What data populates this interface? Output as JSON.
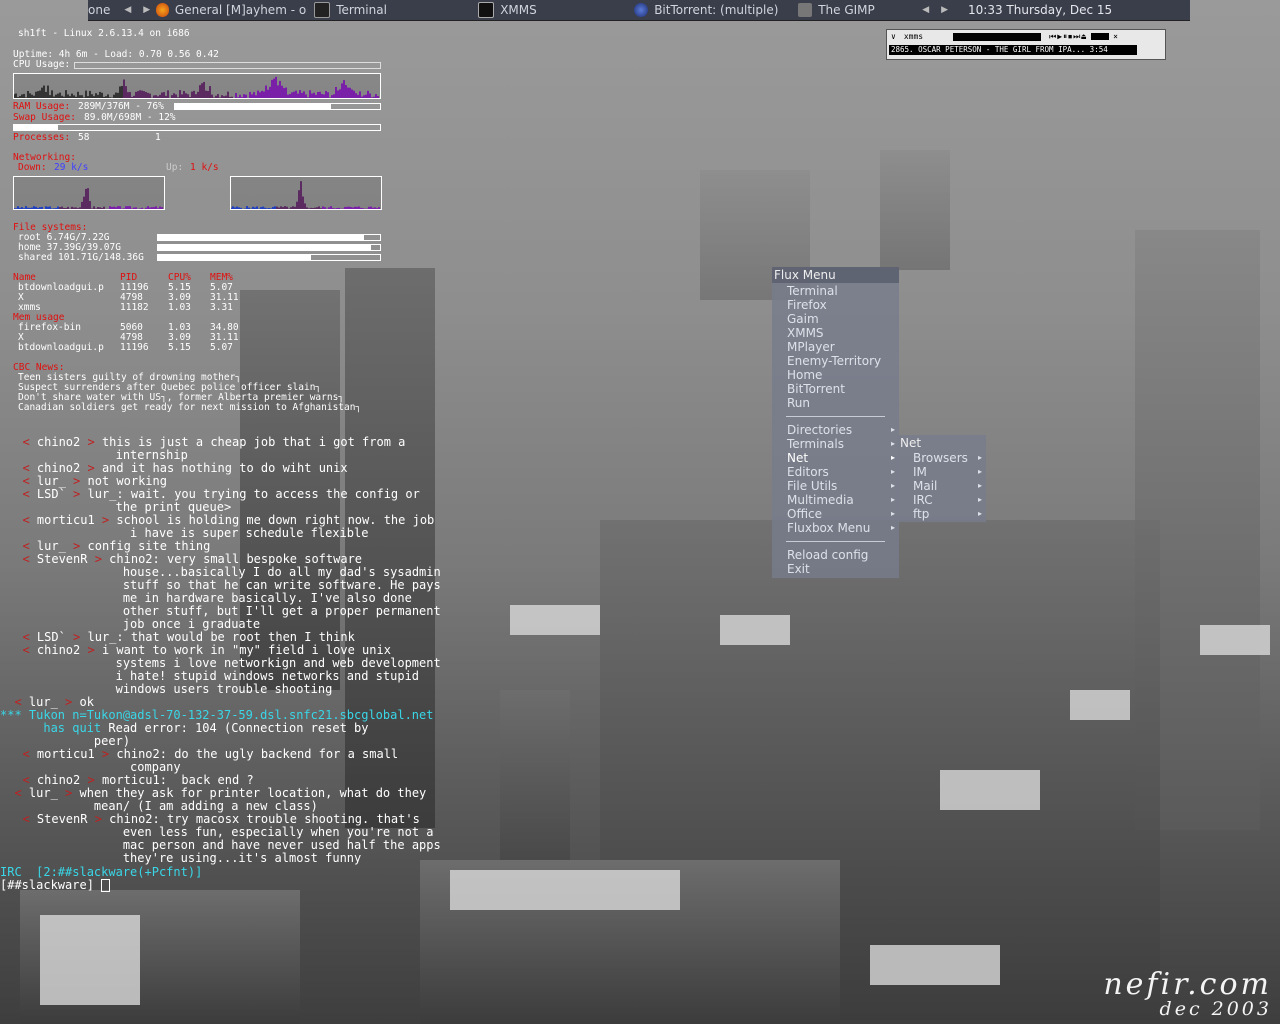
{
  "taskbar": {
    "items": [
      "one",
      "General [M]ayhem - o",
      "Terminal",
      "XMMS",
      "BitTorrent: (multiple)",
      "The GIMP"
    ],
    "clock": "10:33 Thursday, Dec 15"
  },
  "conky": {
    "header": "sh1ft - Linux 2.6.13.4 on i686",
    "uptime": "Uptime: 4h 6m - Load: 0.70 0.56 0.42",
    "cpu_label": "CPU Usage:",
    "ram_label": "RAM Usage:",
    "ram_value": "289M/376M - 76%",
    "ram_fraction": 0.76,
    "swap_label": "Swap Usage:",
    "swap_value": "89.0M/698M - 12%",
    "swap_fraction": 0.12,
    "processes_label": "Processes:",
    "processes_total": "58",
    "processes_running": "1",
    "network_label": "Networking:",
    "down_label": "Down:",
    "down_value": "29 k/s",
    "up_label": "Up:",
    "up_value": "1 k/s",
    "fs_label": "File systems:",
    "fs": [
      {
        "text": "root 6.74G/7.22G",
        "fraction": 0.93
      },
      {
        "text": "home 37.39G/39.07G",
        "fraction": 0.96
      },
      {
        "text": "shared 101.71G/148.36G",
        "fraction": 0.69
      }
    ],
    "top_headers": [
      "Name",
      "PID",
      "CPU%",
      "MEM%"
    ],
    "top_cpu": [
      [
        "btdownloadgui.p",
        "11196",
        "5.15",
        "5.07"
      ],
      [
        "X",
        "4798",
        "3.09",
        "31.11"
      ],
      [
        "xmms",
        "11182",
        "1.03",
        "3.31"
      ]
    ],
    "mem_label": "Mem usage",
    "top_mem": [
      [
        "firefox-bin",
        "5060",
        "1.03",
        "34.80"
      ],
      [
        "X",
        "4798",
        "3.09",
        "31.11"
      ],
      [
        "btdownloadgui.p",
        "11196",
        "5.15",
        "5.07"
      ]
    ],
    "cbc_label": "CBC News:",
    "news": [
      "Teen sisters guilty of drowning mother┐",
      "Suspect surrenders after Quebec police officer slain┐",
      "Don't share water with US┐, former Alberta premier warns┐",
      "Canadian soldiers get ready for next mission to Afghanistan┐"
    ]
  },
  "irc": {
    "lines": [
      {
        "nick": "chino2",
        "text": "this is just a cheap job that i got from a"
      },
      {
        "cont": "internship",
        "indent": "                "
      },
      {
        "nick": "chino2",
        "text": "and it has nothing to do wiht unix"
      },
      {
        "nick": "lur_",
        "text": "not working"
      },
      {
        "nick": "LSD`",
        "text": "lur_: wait. you trying to access the config or"
      },
      {
        "cont": "the print queue>",
        "indent": "                "
      },
      {
        "nick": "morticu1",
        "text": "school is holding me down right now. the job"
      },
      {
        "cont": "i have is super schedule flexible",
        "indent": "                  "
      },
      {
        "nick": "lur_",
        "text": "config site thing"
      },
      {
        "nick": "StevenR",
        "text": "chino2: very small bespoke software"
      },
      {
        "cont": "house...basically I do all my dad's sysadmin",
        "indent": "                 "
      },
      {
        "cont": "stuff so that he can write software. He pays",
        "indent": "                 "
      },
      {
        "cont": "me in hardware basically. I've also done",
        "indent": "                 "
      },
      {
        "cont": "other stuff, but I'll get a proper permanent",
        "indent": "                 "
      },
      {
        "cont": "job once i graduate",
        "indent": "                 "
      },
      {
        "nick": "LSD`",
        "text": "lur_: that would be root then I think"
      },
      {
        "nick": "chino2",
        "text": "i want to work in \"my\" field i love unix"
      },
      {
        "cont": "systems i love networkign and web development",
        "indent": "                "
      },
      {
        "cont": "i hate! stupid windows networks and stupid",
        "indent": "                "
      },
      {
        "cont": "windows users trouble shooting",
        "indent": "                "
      },
      {
        "nick": "lur_",
        "text": "ok",
        "self": true
      },
      {
        "quit": "*** Tukon n=Tukon@adsl-70-132-37-59.dsl.snfc21.sbcglobal.net"
      },
      {
        "quit2": "has quit",
        "reason": " Read error: 104 (Connection reset by"
      },
      {
        "cont": "peer)",
        "indent": "             "
      },
      {
        "nick": "morticu1",
        "text": "chino2: do the ugly backend for a small"
      },
      {
        "cont": "company",
        "indent": "                  "
      },
      {
        "nick": "chino2",
        "text": "morticu1:  back end ?"
      },
      {
        "nick": "lur_",
        "text": "when they ask for printer location, what do they",
        "self": true
      },
      {
        "cont": "mean/ (I am adding a new class)",
        "indent": "             "
      },
      {
        "nick": "StevenR",
        "text": "chino2: try macosx trouble shooting. that's"
      },
      {
        "cont": "even less fun, especially when you're not a",
        "indent": "                 "
      },
      {
        "cont": "mac person and have never used half the apps",
        "indent": "                 "
      },
      {
        "cont": "they're using...it's almost funny",
        "indent": "                 "
      }
    ],
    "status": "IRC  [2:##slackware(+Pcfnt)]",
    "prompt": "[##slackware] "
  },
  "xmms": {
    "title": "xmms",
    "song": "2865. OSCAR PETERSON - THE GIRL FROM IPA... 3:54"
  },
  "flux_menu": {
    "title": "Flux Menu",
    "apps": [
      "Terminal",
      "Firefox",
      "Gaim",
      "XMMS",
      "MPlayer",
      "Enemy-Territory",
      "Home",
      "BitTorrent",
      "Run"
    ],
    "submenus": [
      "Directories",
      "Terminals",
      "Net",
      "Editors",
      "File Utils",
      "Multimedia",
      "Office",
      "Fluxbox Menu"
    ],
    "actions": [
      "Reload config",
      "Exit"
    ]
  },
  "net_menu": {
    "title": "Net",
    "items": [
      "Browsers",
      "IM",
      "Mail",
      "IRC",
      "ftp"
    ]
  },
  "signature": {
    "line1": "nefir.com",
    "line2": "dec 2003"
  }
}
